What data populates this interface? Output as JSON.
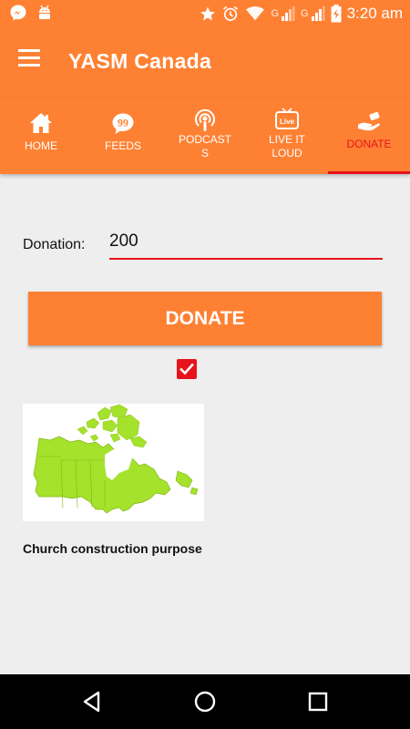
{
  "status_bar": {
    "time": "3:20 am",
    "network_1": "G",
    "network_2": "G",
    "icons": [
      "messenger-icon",
      "android-icon",
      "star-icon",
      "alarm-icon",
      "wifi-icon",
      "signal-icon",
      "signal-icon",
      "battery-charging-icon"
    ]
  },
  "app_bar": {
    "title": "YASM Canada",
    "menu_icon": "hamburger-menu-icon"
  },
  "tabs": [
    {
      "label": "HOME",
      "icon": "home-icon",
      "active": false
    },
    {
      "label": "FEEDS",
      "icon": "speech-bubble-icon",
      "active": false
    },
    {
      "label": "PODCAST\nS",
      "icon": "podcast-icon",
      "active": false
    },
    {
      "label": "LIVE IT\nLOUD",
      "icon": "live-tv-icon",
      "active": false
    },
    {
      "label": "DONATE",
      "icon": "donate-hand-icon",
      "active": true
    }
  ],
  "form": {
    "donation_label": "Donation:",
    "donation_value": "200",
    "donate_button": "DONATE",
    "checkbox_checked": true
  },
  "purpose": {
    "image": "canada-map-image",
    "caption": "Church construction purpose"
  },
  "colors": {
    "primary": "#fe8133",
    "accent": "#e8141b",
    "background": "#eeeeee",
    "map_fill": "#a5e22b"
  },
  "nav_bar": {
    "icons": [
      "back-icon",
      "home-circle-icon",
      "recents-square-icon"
    ]
  }
}
